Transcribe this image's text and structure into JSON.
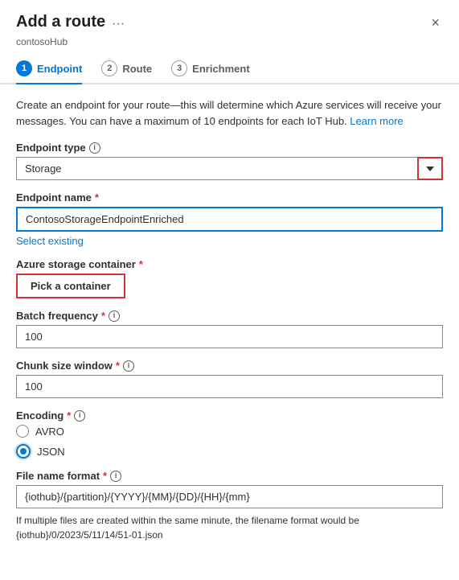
{
  "panel": {
    "title": "Add a route",
    "subtitle": "contosoHub",
    "close_label": "×",
    "more_label": "···"
  },
  "steps": [
    {
      "number": "1",
      "label": "Endpoint",
      "active": true,
      "filled": true
    },
    {
      "number": "2",
      "label": "Route",
      "active": false,
      "filled": false
    },
    {
      "number": "3",
      "label": "Enrichment",
      "active": false,
      "filled": false
    }
  ],
  "description": "Create an endpoint for your route—this will determine which Azure services will receive your messages. You can have a maximum of 10 endpoints for each IoT Hub.",
  "learn_more": "Learn more",
  "endpoint_type": {
    "label": "Endpoint type",
    "value": "Storage",
    "required": false
  },
  "endpoint_name": {
    "label": "Endpoint name",
    "value": "ContosoStorageEndpointEnriched",
    "required": true
  },
  "select_existing": "Select existing",
  "azure_storage_container": {
    "label": "Azure storage container",
    "required": true
  },
  "pick_container_btn": "Pick a container",
  "batch_frequency": {
    "label": "Batch frequency",
    "value": "100",
    "required": true
  },
  "chunk_size_window": {
    "label": "Chunk size window",
    "value": "100",
    "required": true
  },
  "encoding": {
    "label": "Encoding",
    "required": true,
    "options": [
      {
        "value": "AVRO",
        "label": "AVRO",
        "selected": false
      },
      {
        "value": "JSON",
        "label": "JSON",
        "selected": true
      }
    ]
  },
  "file_name_format": {
    "label": "File name format",
    "value": "{iothub}/{partition}/{YYYY}/{MM}/{DD}/{HH}/{mm}",
    "required": true
  },
  "file_format_note": "If multiple files are created within the same minute, the filename format would be {iothub}/0/2023/5/11/14/51-01.json"
}
